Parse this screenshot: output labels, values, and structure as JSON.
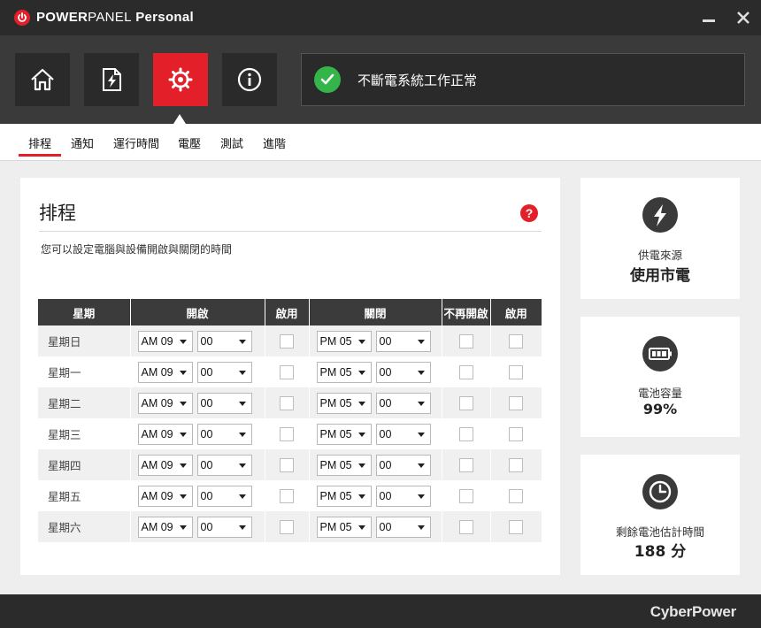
{
  "titlebar": {
    "title_bold": "POWER",
    "title_light": "PANEL",
    "title_suffix": " Personal",
    "minimize_icon": "minimize-icon",
    "close_icon": "close-icon"
  },
  "nav": {
    "items": [
      {
        "icon": "home-icon",
        "active": false
      },
      {
        "icon": "power-file-icon",
        "active": false
      },
      {
        "icon": "gear-icon",
        "active": true
      },
      {
        "icon": "info-icon",
        "active": false
      }
    ]
  },
  "status": {
    "text": "不斷電系統工作正常",
    "icon": "check-circle-icon",
    "color": "#33b54a"
  },
  "tabs": [
    {
      "label": "排程",
      "selected": true
    },
    {
      "label": "通知",
      "selected": false
    },
    {
      "label": "運行時間",
      "selected": false
    },
    {
      "label": "電壓",
      "selected": false
    },
    {
      "label": "測試",
      "selected": false
    },
    {
      "label": "進階",
      "selected": false
    }
  ],
  "schedule": {
    "title": "排程",
    "description": "您可以設定電腦與設備開啟與關閉的時間",
    "help": "?",
    "headers": {
      "day": "星期",
      "on": "開啟",
      "on_enable": "啟用",
      "off": "關閉",
      "no_restart": "不再開啟",
      "off_enable": "啟用"
    },
    "rows": [
      {
        "day": "星期日",
        "on_hour": "AM 09",
        "on_min": "00",
        "off_hour": "PM 05",
        "off_min": "00"
      },
      {
        "day": "星期一",
        "on_hour": "AM 09",
        "on_min": "00",
        "off_hour": "PM 05",
        "off_min": "00"
      },
      {
        "day": "星期二",
        "on_hour": "AM 09",
        "on_min": "00",
        "off_hour": "PM 05",
        "off_min": "00"
      },
      {
        "day": "星期三",
        "on_hour": "AM 09",
        "on_min": "00",
        "off_hour": "PM 05",
        "off_min": "00"
      },
      {
        "day": "星期四",
        "on_hour": "AM 09",
        "on_min": "00",
        "off_hour": "PM 05",
        "off_min": "00"
      },
      {
        "day": "星期五",
        "on_hour": "AM 09",
        "on_min": "00",
        "off_hour": "PM 05",
        "off_min": "00"
      },
      {
        "day": "星期六",
        "on_hour": "AM 09",
        "on_min": "00",
        "off_hour": "PM 05",
        "off_min": "00"
      }
    ]
  },
  "cards": {
    "power_source": {
      "label": "供電來源",
      "value": "使用市電",
      "icon": "lightning-icon"
    },
    "battery": {
      "label": "電池容量",
      "value": "99%",
      "icon": "battery-icon"
    },
    "runtime": {
      "label": "剩餘電池估計時間",
      "value": "188 分",
      "icon": "clock-icon"
    }
  },
  "footer": {
    "brand": "CyberPower"
  },
  "colors": {
    "accent": "#e3202a",
    "dark": "#2b2b2b",
    "ok": "#33b54a"
  }
}
